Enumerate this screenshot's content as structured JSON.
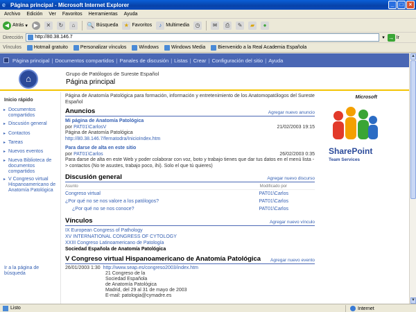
{
  "window": {
    "title": "Página principal - Microsoft Internet Explorer"
  },
  "menu": [
    "Archivo",
    "Edición",
    "Ver",
    "Favoritos",
    "Herramientas",
    "Ayuda"
  ],
  "toolbar": {
    "back": "Atrás",
    "search": "Búsqueda",
    "favorites": "Favoritos",
    "multimedia": "Multimedia"
  },
  "address": {
    "label": "Dirección",
    "value": "http://80.38.146.7",
    "go": "Ir"
  },
  "links": {
    "label": "Vínculos",
    "items": [
      "Hotmail gratuito",
      "Personalizar vínculos",
      "Windows",
      "Windows Media",
      "Bienvenido a la Real Academia Española"
    ]
  },
  "spnav": {
    "items": [
      "Página principal",
      "Documentos compartidos",
      "Panales de discusión",
      "Listas",
      "Crear",
      "Configuración del sitio",
      "Ayuda"
    ]
  },
  "site": {
    "group": "Grupo de Patólogos de Sureste Español",
    "page_title": "Página principal"
  },
  "quicklaunch": {
    "heading": "Inicio rápido",
    "items": [
      "Documentos compartidos",
      "Discusión general",
      "Contactos",
      "Tareas",
      "Nuevos eventos",
      "Nueva Biblioteca de documentos compartidos",
      "V Congreso virtual Hispanoamericano de Anatomía Patológica"
    ],
    "goback": "Ir a la página de búsqueda"
  },
  "intro": "Página de Anatomía Patológica para formación, información y entretenimiento de los Anatomopatólogos del Sureste Español",
  "announcements": {
    "title": "Anuncios",
    "add": "Agregar nuevo anuncio",
    "items": [
      {
        "title": "Mi página de Anatomía Patológica",
        "by_label": "por",
        "by": "PAT01\\CarlosV",
        "date": "21/02/2003 19:15",
        "body": "Página de Anatomía Patológica",
        "url": "http://80.38.146.7/fernatodra/InicioIndex.htm"
      },
      {
        "title": "Para darse de alta en este sitio",
        "by_label": "por",
        "by": "PAT01\\Carlos",
        "date": "26/02/2003 0:35",
        "body": "Para darse de alta en este Web y poder colaborar con voz, boto y trabajo tienes que dar tus datos en el menú lista -> contactos (No te asustes, trabajo poco, ihi). Solo el que tú quieres)",
        "url": ""
      }
    ]
  },
  "discussion": {
    "title": "Discusión general",
    "add": "Agregar nuevo discurso",
    "col_subject": "Asunto",
    "col_by": "Modificado por",
    "rows": [
      {
        "subject": "Congreso virtual",
        "by": "PAT01\\Carlos",
        "indent": false
      },
      {
        "subject": "¿Por qué no se nos valore a los patólogos?",
        "by": "PAT01\\Carlos",
        "indent": false
      },
      {
        "subject": "¿Por qué no se nos conoce?",
        "by": "PAT01\\Carlos",
        "indent": true
      }
    ]
  },
  "links_section": {
    "title": "Vínculos",
    "add": "Agregar nuevo vínculo",
    "items": [
      "IX European Congress of Pathology",
      "XV INTERNATIONAL CONGRESS OF CYTOLOGY",
      "XXIII Congreso Latinoamericano de Patología"
    ],
    "bold_item": "Sociedad Española de Anatomía Patológica"
  },
  "congress": {
    "title": "V Congreso virtual Hispanoamericano de Anatomía Patológica",
    "add": "Agregar nuevo evento",
    "date": "26/01/2003 1:30",
    "url": "http://www.seap.es/congreso2003/index.htm",
    "lines": [
      "21 Congreso de la",
      "Sociedad Española",
      "de Anatomía Patológica",
      "Madrid, del 29 al 31 de mayo de 2003",
      "E-mail: patologia@cymadre.es"
    ]
  },
  "sharepoint": {
    "microsoft": "Microsoft",
    "name": "SharePoint",
    "sub": "Team Services"
  },
  "status": {
    "left": "Listo",
    "zone": "Internet"
  },
  "colors": {
    "nav_blue": "#4a67b4",
    "link_blue": "#3560b3",
    "accent_yellow": "#f4c400",
    "titlebar": "#0a5fd8"
  }
}
